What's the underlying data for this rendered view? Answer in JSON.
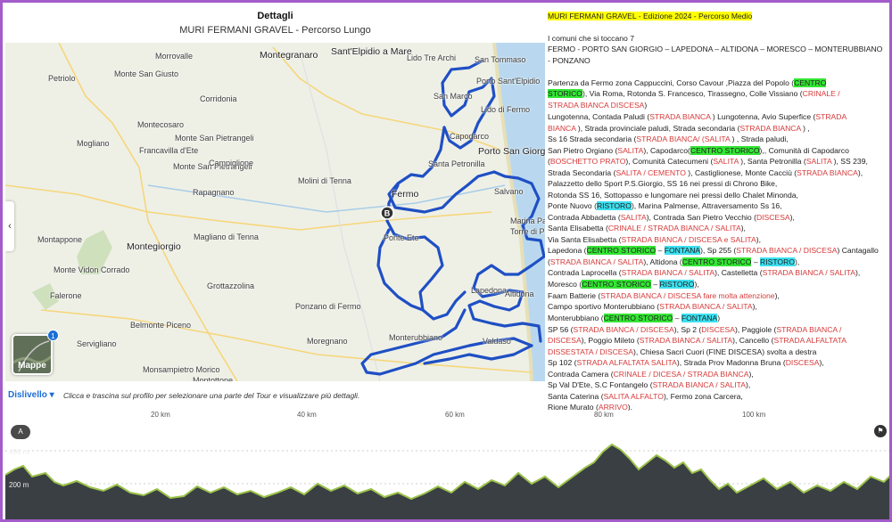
{
  "header": {
    "title": "Dettagli",
    "subtitle": "MURI FERMANI GRAVEL - Percorso Lungo"
  },
  "map": {
    "places": [
      {
        "name": "Montegranaro"
      },
      {
        "name": "Sant'Elpidio a Mare"
      },
      {
        "name": "Petriolo"
      },
      {
        "name": "Monte San Giusto"
      },
      {
        "name": "Morrovalle"
      },
      {
        "name": "Lido Tre Archi"
      },
      {
        "name": "Porto Sant'Elpidio"
      },
      {
        "name": "San Tommaso"
      },
      {
        "name": "Corridonia"
      },
      {
        "name": "San Marco"
      },
      {
        "name": "Lido di Fermo"
      },
      {
        "name": "Mogliano"
      },
      {
        "name": "Monte San Pietrangeli"
      },
      {
        "name": "Francavilla d'Ete"
      },
      {
        "name": "Monte San Pietrangeli"
      },
      {
        "name": "Capodarco"
      },
      {
        "name": "Porto San Giorgio"
      },
      {
        "name": "Montecosaro"
      },
      {
        "name": "Campiglione"
      },
      {
        "name": "Santa Petronilla"
      },
      {
        "name": "Molini di Tenna"
      },
      {
        "name": "Salvano"
      },
      {
        "name": "Rapagnano"
      },
      {
        "name": "Fermo"
      },
      {
        "name": "Marina Palmense"
      },
      {
        "name": "Torre di Palme"
      },
      {
        "name": "Montappone"
      },
      {
        "name": "Magliano di Tenna"
      },
      {
        "name": "Ponte Ete"
      },
      {
        "name": "Montegiorgio"
      },
      {
        "name": "Monte Vidon Corrado"
      },
      {
        "name": "Grottazzolina"
      },
      {
        "name": "Lapedona"
      },
      {
        "name": "Falerone"
      },
      {
        "name": "Altidona"
      },
      {
        "name": "Ponzano di Fermo"
      },
      {
        "name": "Servigliano"
      },
      {
        "name": "Belmonte Piceno"
      },
      {
        "name": "Monterubbiano"
      },
      {
        "name": "Moregnano"
      },
      {
        "name": "Valdaso"
      },
      {
        "name": "Monsampietro Morico"
      },
      {
        "name": "Montottone"
      }
    ],
    "marker_label": "B",
    "layers_button": "Mappe",
    "layers_badge": "1",
    "route_color": "#1f4fc4"
  },
  "profile": {
    "label": "Dislivello",
    "hint": "Clicca e trascina sul profilo per selezionare una parte del Tour e visualizzare più dettagli.",
    "km_ticks": [
      "20 km",
      "40 km",
      "60 km",
      "80 km",
      "100 km"
    ],
    "alt_ticks": [
      "400 m",
      "200 m"
    ],
    "start_label": "A",
    "fill_color": "#3a3f43"
  },
  "description": {
    "title": "MURI FERMANI GRAVEL -   Edizione 2024  - Percorso Medio",
    "intro": "I comuni che si toccano 7",
    "comuni_1": "FERMO - PORTO SAN GIORGIO – LAPEDONA – ALTIDONA – MORESCO – MONTERUBBIANO",
    "comuni_2": "- PONZANO",
    "l1a": "Partenza da Fermo zona Cappuccini,  Corso Cavour ,Piazza del Popolo (",
    "l1b": "CENTRO",
    "l2a": "STORICO",
    "l2b": "), Via Roma, Rotonda S. Francesco, Tirassegno, Colle Vissiano (",
    "l2c": "CRINALE /",
    "l3a": "STRADA BIANCA DISCESA",
    "l3b": ")",
    "l4a": "Lungotenna, Contada Paludi (",
    "l4b": "STRADA BIANCA",
    "l4c": " ) Lungotenna, Avio Superfice (",
    "l4d": "STRADA",
    "l5a": "BIANCA",
    "l5b": " ), Strada provinciale paludi, Strada secondaria (",
    "l5c": "STRADA BIANCA",
    "l5d": " ) ,",
    "l6a": "Ss 16 Strada secondaria (",
    "l6b": "STRADA BIANCA/ (SALITA",
    "l6c": " ) , Strada paludi,",
    "l7a": "San Pietro Orgiano (",
    "l7b": "SALITA",
    "l7c": "), Capodarco(",
    "l7d": "CENTRO STORICO",
    "l7e": "),, Comunità di Capodarco",
    "l8a": "(",
    "l8b": "BOSCHETTO PRATO",
    "l8c": "), Comunità Catecumeni (",
    "l8d": "SALITA",
    "l8e": " ), Santa Petronilla (",
    "l8f": "SALITA",
    "l8g": " ),  SS 239,",
    "l9a": "Strada Secondaria (",
    "l9b": "SALITA / CEMENTO",
    "l9c": " ), Castiglionese, Monte Cacciù (",
    "l9d": "STRADA BIANCA",
    "l9e": "),",
    "l10": "Palazzetto dello Sport P.S.Giorgio, SS 16 nei pressi di Chrono Bike,",
    "l11": "Rotonda SS 16, Sottopasso e lungomare nei pressi dello Chalet Minonda,",
    "l12a": "Ponte Nuovo (",
    "l12b": "RISTORO",
    "l12c": "), Marina Palmense, Attraversamento Ss 16,",
    "l13a": "Contrada Abbadetta (",
    "l13b": "SALITA",
    "l13c": "), Contrada  San Pietro Vecchio (",
    "l13d": "DISCESA",
    "l13e": "),",
    "l14a": "Santa Elisabetta (",
    "l14b": "CRINALE / STRADA BIANCA / SALITA",
    "l14c": "),",
    "l15a": "Via Santa Elisabetta (",
    "l15b": "STRADA BIANCA / DISCESA e SALITA",
    "l15c": "),",
    "l16a": "Lapedona (",
    "l16b": "CENTRO STORICO",
    "l16c": " – ",
    "l16d": "FONTANA",
    "l16e": "), Sp 255 (",
    "l16f": "STRADA BIANCA / DISCESA",
    "l16g": ") Cantagallo",
    "l17a": "(",
    "l17b": "STRADA BIANCA / SALITA",
    "l17c": "), Altidona (",
    "l17d": "CENTRO STORICO",
    "l17e": " – ",
    "l17f": "RISTORO",
    "l17g": "),",
    "l18a": "Contrada Laprocella (",
    "l18b": "STRADA BIANCA / SALITA",
    "l18c": "), Castelletta (",
    "l18d": "STRADA BIANCA / SALITA",
    "l18e": "),",
    "l19a": "Moresco (",
    "l19b": "CENTRO STORICO",
    "l19c": " – ",
    "l19d": "RISTORO",
    "l19e": "),",
    "l20a": "Faam Batterie (",
    "l20b": "STRADA BIANCA / DISCESA fare molta attenzione",
    "l20c": "),",
    "l21a": "Campo sportivo Monterubbiano (",
    "l21b": "STRADA BIANCA / SALITA",
    "l21c": "),",
    "l22a": "Monterubbiano (",
    "l22b": "CENTRO STORICO",
    "l22c": " – ",
    "l22d": "FONTANA",
    "l22e": ")",
    "l23a": "SP 56 (",
    "l23b": "STRADA BIANCA / DISCESA",
    "l23c": "), Sp 2 (",
    "l23d": "DISCESA",
    "l23e": "), Paggiole  (",
    "l23f": "STRADA BIANCA /",
    "l24a": "DISCESA",
    "l24b": "), Poggio Mileto (",
    "l24c": "STRADA BIANCA / SALITA",
    "l24d": "), Cancello (",
    "l24e": "STRADA ALFALTATA",
    "l25a": "DISSESTATA / DISCESA",
    "l25b": "), Chiesa Sacri Cuori (FINE DISCESA) svolta a destra",
    "l26a": "Sp 102 (",
    "l26b": "STRADA ALFALTATA SALITA",
    "l26c": "), Strada Prov Madonna Bruna (",
    "l26d": "DISCESA",
    "l26e": "),",
    "l27a": "Contrada Camera (",
    "l27b": "CRINALE / DICESA / STRADA BIANCA",
    "l27c": "),",
    "l28a": "Sp Val D'Ete, S.C Fontangelo (",
    "l28b": "STRADA BIANCA / SALITA",
    "l28c": "),",
    "l29a": "Santa Caterina (",
    "l29b": "SALITA ALFALTO",
    "l29c": "), Fermo zona Carcera,",
    "l30a": "Rione Murato (",
    "l30b": "ARRIVO",
    "l30c": ")."
  }
}
